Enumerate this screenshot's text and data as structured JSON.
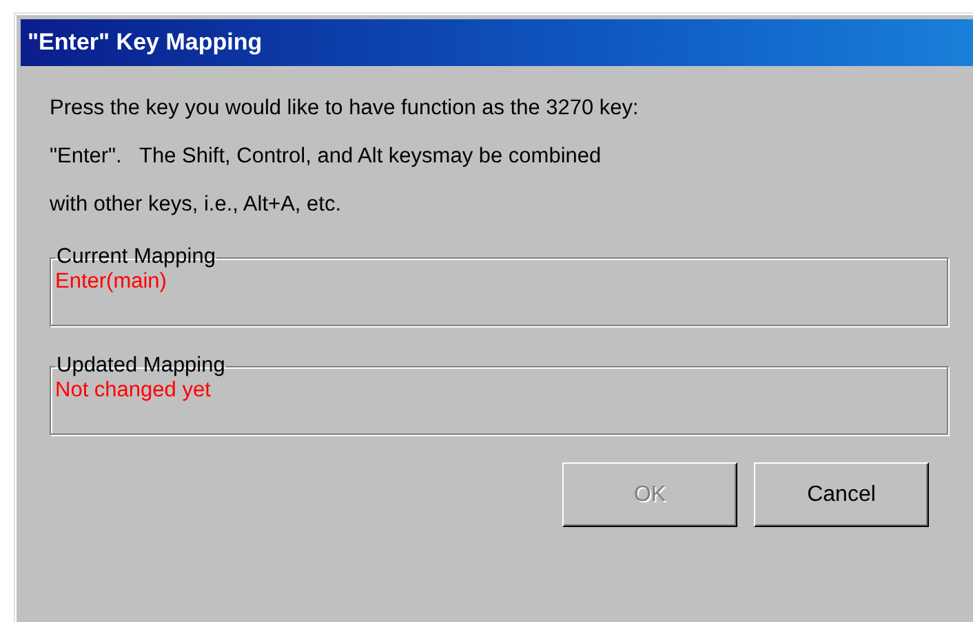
{
  "window": {
    "title": "\"Enter\" Key Mapping"
  },
  "instructions": "Press the key you would like to have function as the 3270 key:\n\"Enter\".   The Shift, Control, and Alt keysmay be combined\nwith other keys, i.e., Alt+A, etc.",
  "groups": [
    {
      "label": "Current Mapping",
      "value": "Enter(main)"
    },
    {
      "label": "Updated Mapping",
      "value": "Not changed yet"
    }
  ],
  "buttons": [
    {
      "label": "OK",
      "disabled": true
    },
    {
      "label": "Cancel",
      "disabled": false
    }
  ]
}
